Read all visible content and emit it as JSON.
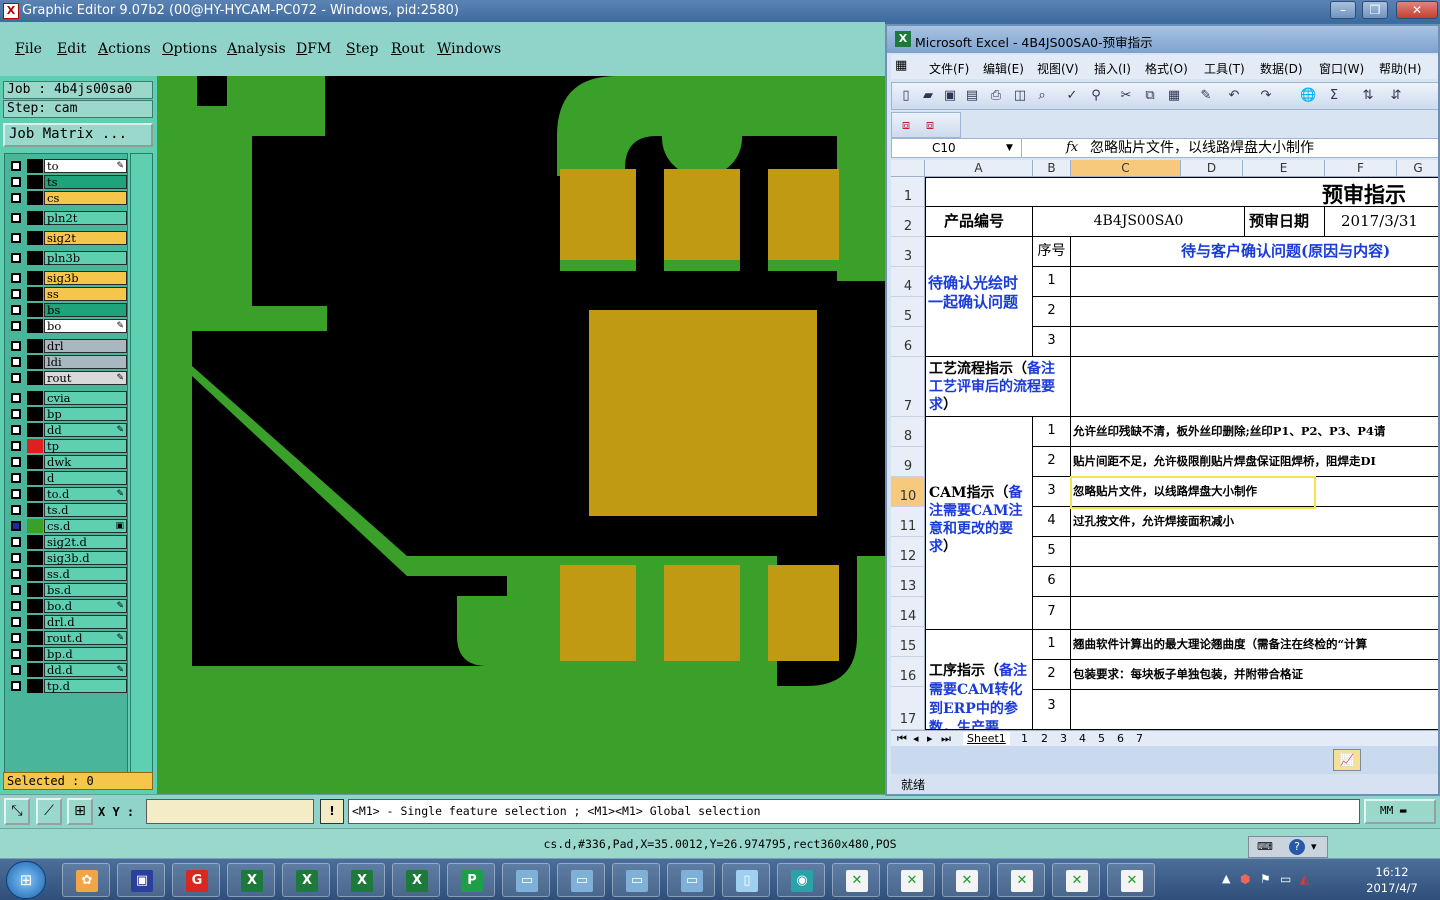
{
  "graphic_editor": {
    "window_title": "Graphic Editor 9.07b2 (00@HY-HYCAM-PC072 - Windows, pid:2580)",
    "menu": [
      "File",
      "Edit",
      "Actions",
      "Options",
      "Analysis",
      "DFM",
      "Step",
      "Rout",
      "Windows"
    ],
    "job_label": "Job : 4b4js00sa0",
    "step_label": "Step: cam",
    "job_matrix_label": "Job Matrix ...",
    "layers": [
      {
        "name": "to",
        "color": "#ffffff",
        "mark": "✎"
      },
      {
        "name": "ts",
        "color": "#1fa37a"
      },
      {
        "name": "cs",
        "color": "#f5c64a"
      },
      {
        "name": "pln2t",
        "color": "#5fcfb1"
      },
      {
        "name": "sig2t",
        "color": "#f5c64a"
      },
      {
        "name": "pln3b",
        "color": "#5fcfb1"
      },
      {
        "name": "sig3b",
        "color": "#f5c64a"
      },
      {
        "name": "ss",
        "color": "#f5c64a"
      },
      {
        "name": "bs",
        "color": "#1fa37a"
      },
      {
        "name": "bo",
        "color": "#ffffff",
        "mark": "✎"
      },
      {
        "name": "drl",
        "color": "#a9b8c0"
      },
      {
        "name": "ldi",
        "color": "#a9b8c0"
      },
      {
        "name": "rout",
        "color": "#d9d9d9",
        "mark": "✎"
      },
      {
        "name": "cvia",
        "color": "#5fcfb1"
      },
      {
        "name": "bp",
        "color": "#5fcfb1"
      },
      {
        "name": "dd",
        "color": "#5fcfb1",
        "mark": "✎"
      },
      {
        "name": "tp",
        "color": "#5fcfb1",
        "side": "#e02020"
      },
      {
        "name": "dwk",
        "color": "#5fcfb1"
      },
      {
        "name": "d",
        "color": "#5fcfb1"
      },
      {
        "name": "to.d",
        "color": "#5fcfb1",
        "mark": "✎"
      },
      {
        "name": "ts.d",
        "color": "#5fcfb1"
      },
      {
        "name": "cs.d",
        "color": "#5fcfb1",
        "side": "#3ba02a",
        "checked": true,
        "mark": "▣"
      },
      {
        "name": "sig2t.d",
        "color": "#5fcfb1"
      },
      {
        "name": "sig3b.d",
        "color": "#5fcfb1"
      },
      {
        "name": "ss.d",
        "color": "#5fcfb1"
      },
      {
        "name": "bs.d",
        "color": "#5fcfb1"
      },
      {
        "name": "bo.d",
        "color": "#5fcfb1",
        "mark": "✎"
      },
      {
        "name": "drl.d",
        "color": "#5fcfb1"
      },
      {
        "name": "rout.d",
        "color": "#5fcfb1",
        "mark": "✎"
      },
      {
        "name": "bp.d",
        "color": "#5fcfb1"
      },
      {
        "name": "dd.d",
        "color": "#5fcfb1",
        "mark": "✎"
      },
      {
        "name": "tp.d",
        "color": "#5fcfb1"
      }
    ],
    "selected_label": "Selected : 0",
    "xy_label": "X Y :",
    "xy_value": "",
    "hint_text": "<M1> - Single feature selection ; <M1><M1> Global selection",
    "units": "MM",
    "status_line": "cs.d,#336,Pad,X=35.0012,Y=26.974795,rect360x480,POS",
    "colors": {
      "copper": "#3ba02a",
      "pad": "#c09a12",
      "background": "#000000"
    }
  },
  "excel": {
    "window_title": "Microsoft Excel - 4B4JS00SA0-预审指示",
    "menu": [
      "文件(F)",
      "编辑(E)",
      "视图(V)",
      "插入(I)",
      "格式(O)",
      "工具(T)",
      "数据(D)",
      "窗口(W)",
      "帮助(H)"
    ],
    "name_box": "C10",
    "fx": "fx",
    "formula": "忽略贴片文件，以线路焊盘大小制作",
    "columns": [
      "A",
      "B",
      "C",
      "D",
      "E",
      "F",
      "G"
    ],
    "rows": [
      "1",
      "2",
      "3",
      "4",
      "5",
      "6",
      "7",
      "8",
      "9",
      "10",
      "11",
      "12",
      "13",
      "14",
      "15",
      "16",
      "17"
    ],
    "title": "预审指示",
    "product_label": "产品编号",
    "product_value": "4B4JS00SA0",
    "date_label": "预审日期",
    "date_value": "2017/3/31",
    "seq_header": "序号",
    "issue_header": "待与客户确认问题(原因与内容)",
    "section1": "待确认光绘时一起确认问题",
    "section2_black": "工艺流程指示（",
    "section2_blue": "备注工艺评审后的流程要求",
    "section2_end": "）",
    "section3_black": "CAM指示（",
    "section3_blue": "备注需要CAM注意和更改的要求",
    "section3_end": "）",
    "section4_black": "工序指示（",
    "section4_blue": "备注需要CAM转化到ERP中的参数，生产要",
    "seq1": [
      "1",
      "2",
      "3"
    ],
    "seq3": [
      "1",
      "2",
      "3",
      "4",
      "5",
      "6",
      "7"
    ],
    "seq4": [
      "1",
      "2",
      "3"
    ],
    "cam_items": [
      "允许丝印残缺不清，板外丝印删除;丝印P1、P2、P3、P4请",
      "贴片间距不足，允许极限削贴片焊盘保证阻焊桥，阻焊走DI",
      "忽略贴片文件，以线路焊盘大小制作",
      "过孔按文件，允许焊接面积减小"
    ],
    "process_items": [
      "翘曲软件计算出的最大理论翘曲度（需备注在终检的“计算",
      "包装要求：每块板子单独包装，并附带合格证"
    ],
    "sheet_tabs": [
      "Sheet1",
      "1",
      "2",
      "3",
      "4",
      "5",
      "6",
      "7"
    ],
    "status": "就绪"
  },
  "taskbar": {
    "time": "16:12",
    "date": "2017/4/7",
    "apps": [
      "shell-icon",
      "save-icon",
      "g-app-icon",
      "excel-icon",
      "excel-icon",
      "excel-icon",
      "excel-icon",
      "p-app-icon",
      "window-icon",
      "window-icon",
      "window-icon",
      "window-icon",
      "notepad-icon",
      "eye-icon",
      "x-app-icon",
      "x-app-icon",
      "x-app-icon",
      "x-app-icon",
      "x-app-icon",
      "x-app-icon"
    ]
  }
}
